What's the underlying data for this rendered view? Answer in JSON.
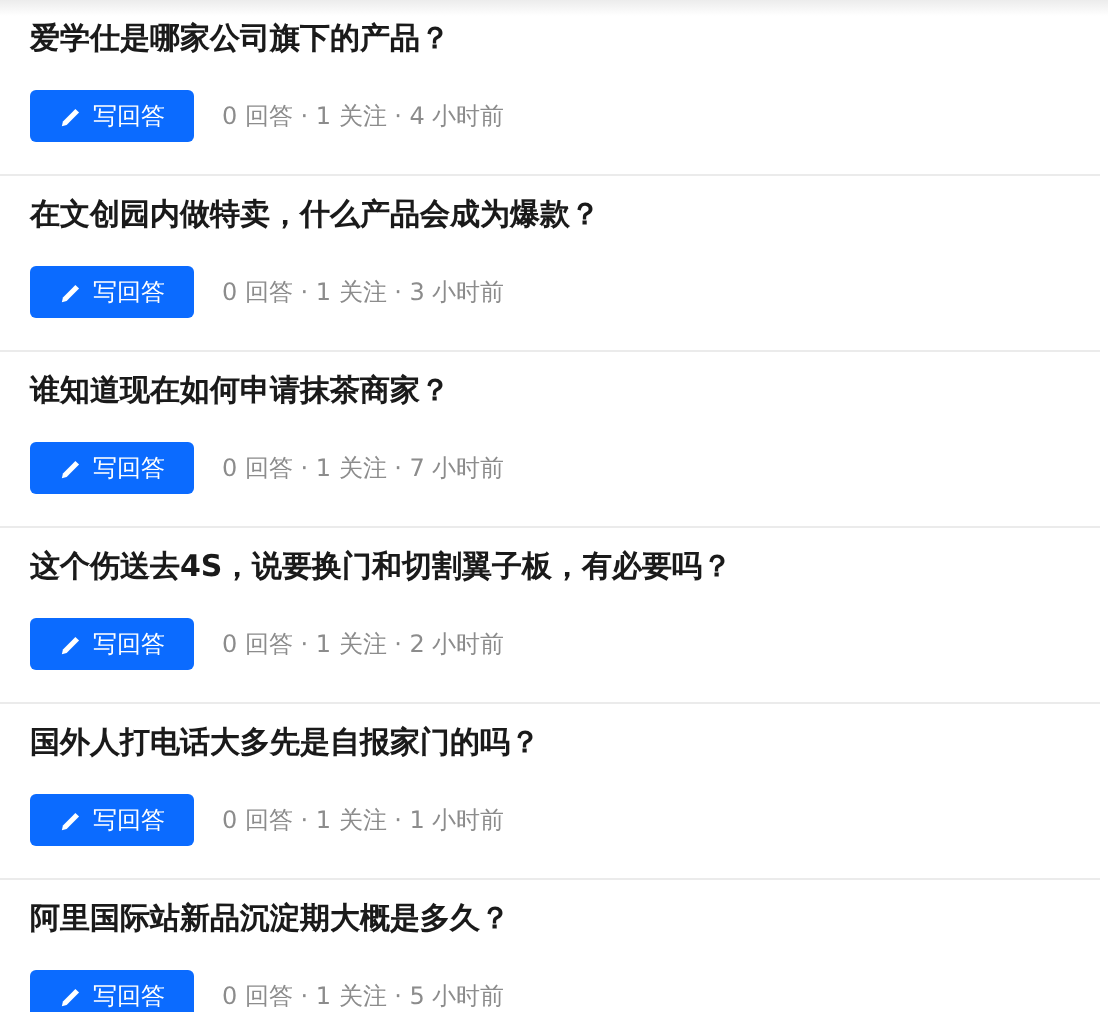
{
  "questions": [
    {
      "title": "爱学仕是哪家公司旗下的产品？",
      "button": "写回答",
      "meta": "0 回答 · 1 关注 · 4 小时前"
    },
    {
      "title": "在文创园内做特卖，什么产品会成为爆款？",
      "button": "写回答",
      "meta": "0 回答 · 1 关注 · 3 小时前"
    },
    {
      "title": "谁知道现在如何申请抹茶商家？",
      "button": "写回答",
      "meta": "0 回答 · 1 关注 · 7 小时前"
    },
    {
      "title": "这个伤送去4S，说要换门和切割翼子板，有必要吗？",
      "button": "写回答",
      "meta": "0 回答 · 1 关注 · 2 小时前"
    },
    {
      "title": "国外人打电话大多先是自报家门的吗？",
      "button": "写回答",
      "meta": "0 回答 · 1 关注 · 1 小时前"
    },
    {
      "title": "阿里国际站新品沉淀期大概是多久？",
      "button": "写回答",
      "meta": "0 回答 · 1 关注 · 5 小时前"
    }
  ]
}
